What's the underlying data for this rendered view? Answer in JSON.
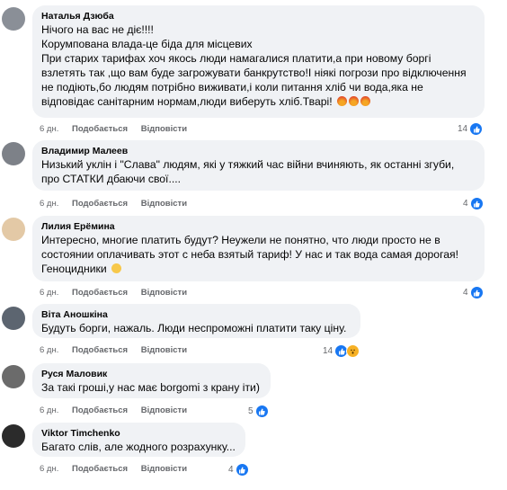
{
  "comments": [
    {
      "author": "Наталья Дзюба",
      "text": "Нічого на вас не діє!!!!\nКорумпована влада-це біда для місцевих \nПри старих тарифах хоч якось люди намагалися платити,а при новому боргі\nвзлетять так ,що вам буде загрожувати банкрутство!І ніякі погрози про відключення\nне подіють,бо людям потрібно виживати,і коли питання хліб чи вода,яка не\nвідповідає санітарним нормам,люди виберуть хліб.Тварі! ",
      "time": "6 дн.",
      "like_label": "Подобається",
      "reply_label": "Відповісти",
      "reaction_count": "14"
    },
    {
      "author": "Владимир Малеев",
      "text": "Низький уклін і \"Слава\" людям, які у тяжкий час війни вчиняють, як останні згуби,\nпро СТАТКИ дбаючи свої....",
      "time": "6 дн.",
      "like_label": "Подобається",
      "reply_label": "Відповісти",
      "reaction_count": "4"
    },
    {
      "author": "Лилия Ерёмина",
      "text": "Интересно, многие платить будут? Неужели не понятно, что люди просто не в\nсостоянии оплачивать этот с неба взятый тариф! У нас и так вода самая дорогая!\nГеноцидники ",
      "time": "6 дн.",
      "like_label": "Подобається",
      "reply_label": "Відповісти",
      "reaction_count": "4"
    },
    {
      "author": "Віта Аношкіна",
      "text": "Будуть борги, нажаль. Люди неспроможні платити таку ціну.",
      "time": "6 дн.",
      "like_label": "Подобається",
      "reply_label": "Відповісти",
      "reaction_count": "14"
    },
    {
      "author": "Руся Маловик",
      "text": "За такі гроші,у нас має borgomi з крану іти)",
      "time": "6 дн.",
      "like_label": "Подобається",
      "reply_label": "Відповісти",
      "reaction_count": "5"
    },
    {
      "author": "Viktor Timchenko",
      "text": "Багато слів, але жодного розрахунку...",
      "time": "6 дн.",
      "like_label": "Подобається",
      "reply_label": "Відповісти",
      "reaction_count": "4"
    }
  ],
  "colors": {
    "like_blue": "#1877f2",
    "bubble_bg": "#f0f2f5",
    "meta_gray": "#65676b"
  },
  "icons": {
    "like": "like-icon",
    "wow": "wow-icon",
    "angry": "angry-emoji-icon",
    "sad": "sad-emoji-icon"
  }
}
